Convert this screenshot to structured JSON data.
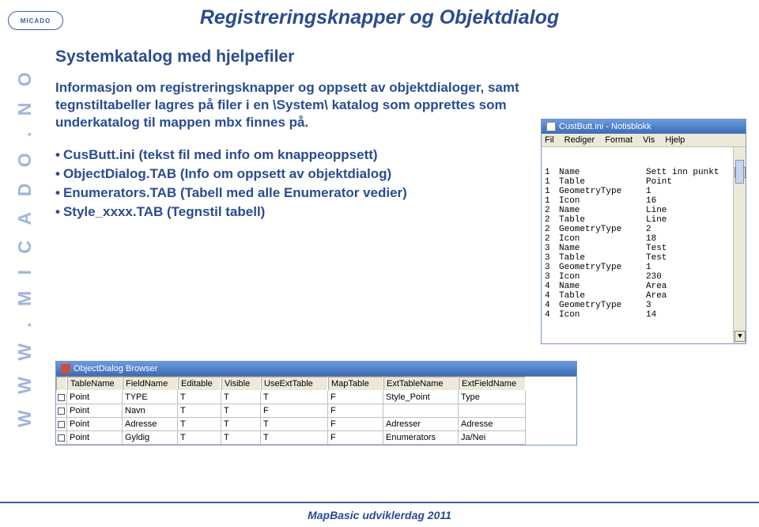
{
  "brand": "MICADO",
  "side_brand": "W W W . M I C A D O . N O",
  "title": "Registreringsknapper og Objektdialog",
  "subtitle": "Systemkatalog med hjelpefiler",
  "paragraph": "Informasjon om registreringsknapper og oppsett av objektdialoger, samt tegnstiltabeller lagres på filer i en \\System\\ katalog som opprettes som underkatalog til mappen mbx finnes på.",
  "bullets": [
    "CusButt.ini (tekst fil med info om knappeoppsett)",
    "ObjectDialog.TAB (Info om oppsett av objektdialog)",
    "Enumerators.TAB (Tabell med alle Enumerator vedier)",
    "Style_xxxx.TAB (Tegnstil tabell)"
  ],
  "footer": "MapBasic udviklerdag 2011",
  "notepad": {
    "title": "CustButt.ini - Notisblokk",
    "menu": [
      "Fil",
      "Rediger",
      "Format",
      "Vis",
      "Hjelp"
    ],
    "rows": [
      {
        "c1": "1",
        "c2": "Name",
        "c3": "Sett inn punkt"
      },
      {
        "c1": "1",
        "c2": "Table",
        "c3": "Point"
      },
      {
        "c1": "1",
        "c2": "GeometryType",
        "c3": "1"
      },
      {
        "c1": "1",
        "c2": "Icon",
        "c3": "16"
      },
      {
        "c1": "",
        "c2": "",
        "c3": ""
      },
      {
        "c1": "2",
        "c2": "Name",
        "c3": "Line"
      },
      {
        "c1": "2",
        "c2": "Table",
        "c3": "Line"
      },
      {
        "c1": "2",
        "c2": "GeometryType",
        "c3": "2"
      },
      {
        "c1": "2",
        "c2": "Icon",
        "c3": "18"
      },
      {
        "c1": "",
        "c2": "",
        "c3": ""
      },
      {
        "c1": "3",
        "c2": "Name",
        "c3": "Test"
      },
      {
        "c1": "3",
        "c2": "Table",
        "c3": "Test"
      },
      {
        "c1": "3",
        "c2": "GeometryType",
        "c3": "1"
      },
      {
        "c1": "3",
        "c2": "Icon",
        "c3": "230"
      },
      {
        "c1": "",
        "c2": "",
        "c3": ""
      },
      {
        "c1": "4",
        "c2": "Name",
        "c3": "Area"
      },
      {
        "c1": "4",
        "c2": "Table",
        "c3": "Area"
      },
      {
        "c1": "4",
        "c2": "GeometryType",
        "c3": "3"
      },
      {
        "c1": "4",
        "c2": "Icon",
        "c3": "14"
      }
    ]
  },
  "browser": {
    "title": "ObjectDialog Browser",
    "headers": [
      "TableName",
      "FieldName",
      "Editable",
      "Visible",
      "UseExtTable",
      "MapTable",
      "ExtTableName",
      "ExtFieldName"
    ],
    "rows": [
      [
        "Point",
        "TYPE",
        "T",
        "T",
        "T",
        "F",
        "Style_Point",
        "Type"
      ],
      [
        "Point",
        "Navn",
        "T",
        "T",
        "F",
        "F",
        "",
        ""
      ],
      [
        "Point",
        "Adresse",
        "T",
        "T",
        "T",
        "F",
        "Adresser",
        "Adresse"
      ],
      [
        "Point",
        "Gyldig",
        "T",
        "T",
        "T",
        "F",
        "Enumerators",
        "Ja/Nei"
      ]
    ]
  }
}
